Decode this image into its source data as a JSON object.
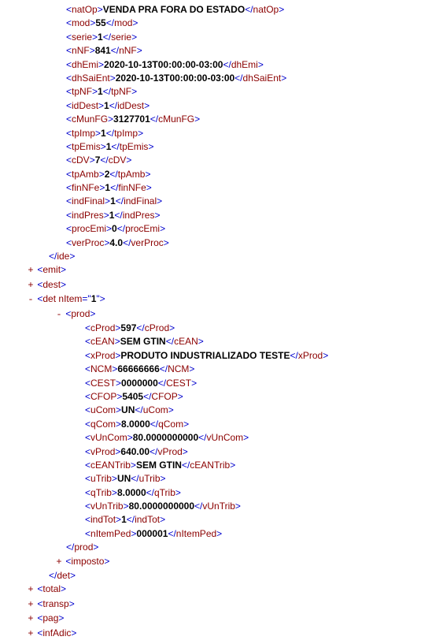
{
  "ide": {
    "natOp": "VENDA PRA FORA DO ESTADO",
    "mod": "55",
    "serie": "1",
    "nNF": "841",
    "dhEmi": "2020-10-13T00:00:00-03:00",
    "dhSaiEnt": "2020-10-13T00:00:00-03:00",
    "tpNF": "1",
    "idDest": "1",
    "cMunFG": "3127701",
    "tpImp": "1",
    "tpEmis": "1",
    "cDV": "7",
    "tpAmb": "2",
    "finNFe": "1",
    "indFinal": "1",
    "indPres": "1",
    "procEmi": "0",
    "verProc": "4.0"
  },
  "det": {
    "nItem": "1",
    "prod": {
      "cProd": "597",
      "cEAN": "SEM GTIN",
      "xProd": "PRODUTO INDUSTRIALIZADO TESTE",
      "NCM": "66666666",
      "CEST": "0000000",
      "CFOP": "5405",
      "uCom": "UN",
      "qCom": "8.0000",
      "vUnCom": "80.0000000000",
      "vProd": "640.00",
      "cEANTrib": "SEM GTIN",
      "uTrib": "UN",
      "qTrib": "8.0000",
      "vUnTrib": "80.0000000000",
      "indTot": "1",
      "nItemPed": "000001"
    }
  },
  "tags": {
    "natOp": "natOp",
    "mod": "mod",
    "serie": "serie",
    "nNF": "nNF",
    "dhEmi": "dhEmi",
    "dhSaiEnt": "dhSaiEnt",
    "tpNF": "tpNF",
    "idDest": "idDest",
    "cMunFG": "cMunFG",
    "tpImp": "tpImp",
    "tpEmis": "tpEmis",
    "cDV": "cDV",
    "tpAmb": "tpAmb",
    "finNFe": "finNFe",
    "indFinal": "indFinal",
    "indPres": "indPres",
    "procEmi": "procEmi",
    "verProc": "verProc",
    "ide": "ide",
    "emit": "emit",
    "dest": "dest",
    "det": "det",
    "nItemAttr": "nItem",
    "prod": "prod",
    "cProd": "cProd",
    "cEAN": "cEAN",
    "xProd": "xProd",
    "NCM": "NCM",
    "CEST": "CEST",
    "CFOP": "CFOP",
    "uCom": "uCom",
    "qCom": "qCom",
    "vUnCom": "vUnCom",
    "vProd": "vProd",
    "cEANTrib": "cEANTrib",
    "uTrib": "uTrib",
    "qTrib": "qTrib",
    "vUnTrib": "vUnTrib",
    "indTot": "indTot",
    "nItemPed": "nItemPed",
    "imposto": "imposto",
    "total": "total",
    "transp": "transp",
    "pag": "pag",
    "infAdic": "infAdic"
  },
  "toggles": {
    "plus": "+",
    "minus": "-"
  }
}
